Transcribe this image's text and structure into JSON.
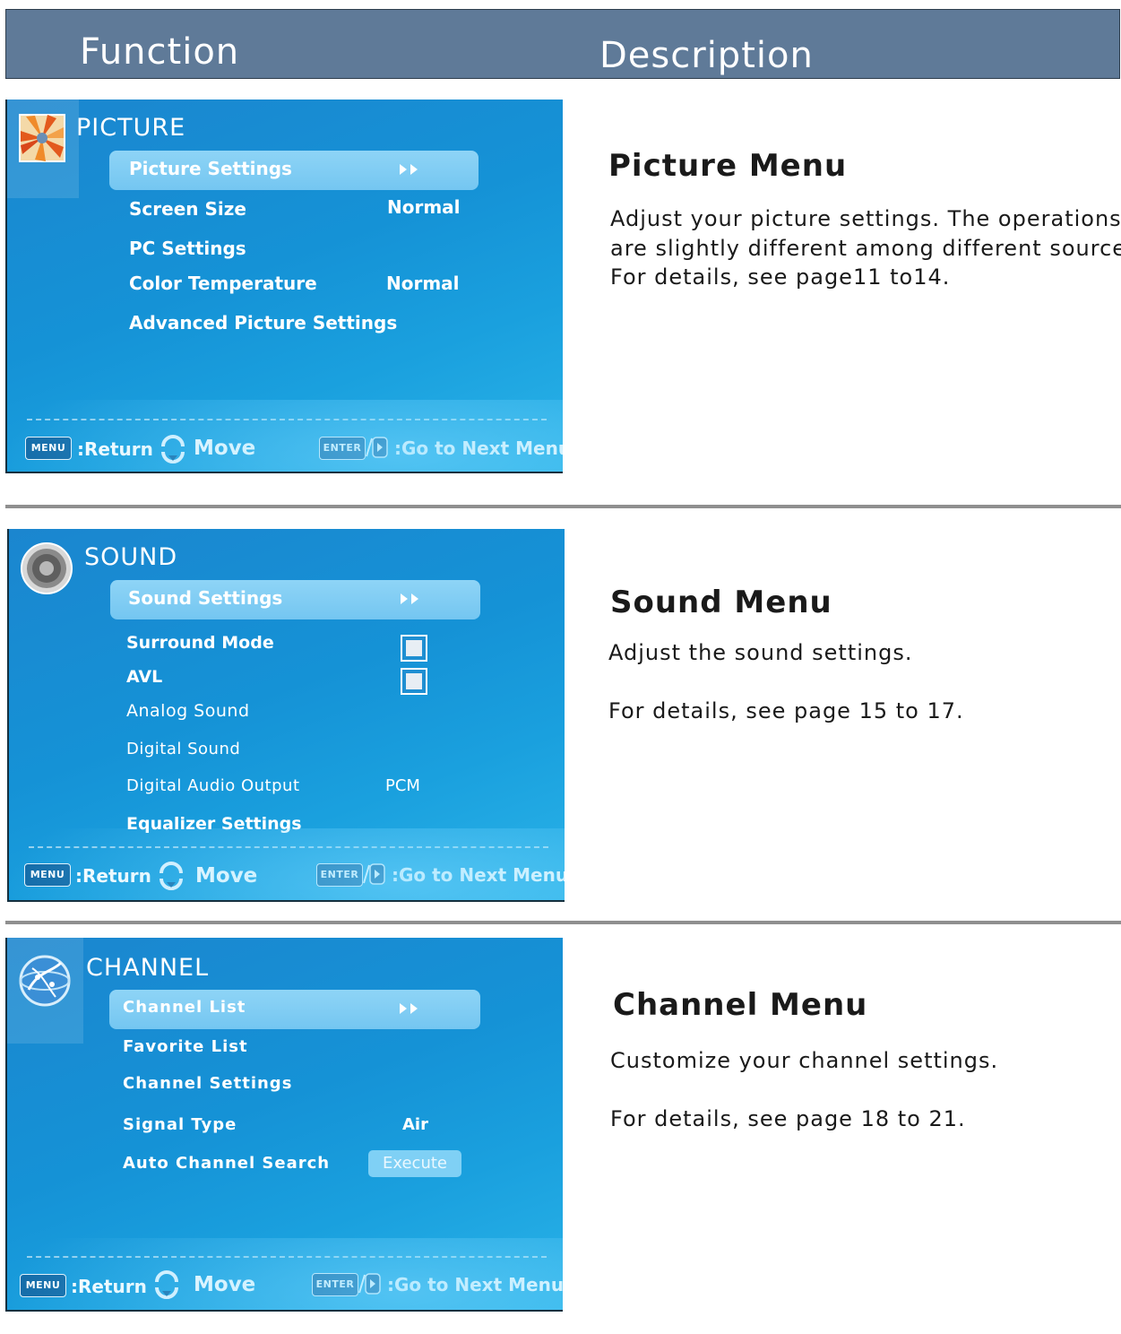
{
  "header": {
    "function_label": "Function",
    "description_label": "Description"
  },
  "picture": {
    "title": "PICTURE",
    "highlight": "Picture Settings",
    "items": [
      {
        "label": "Screen Size",
        "value": "Normal"
      },
      {
        "label": "PC Settings",
        "value": ""
      },
      {
        "label": "Color Temperature",
        "value": "Normal"
      },
      {
        "label": "Advanced Picture Settings",
        "value": ""
      }
    ]
  },
  "sound": {
    "title": "SOUND",
    "highlight": "Sound Settings",
    "items": [
      {
        "label": "Surround Mode"
      },
      {
        "label": "AVL"
      },
      {
        "label": "Analog Sound"
      },
      {
        "label": "Digital Sound"
      },
      {
        "label": "Digital Audio Output",
        "value": "PCM"
      },
      {
        "label": "Equalizer Settings"
      }
    ]
  },
  "channel": {
    "title": "CHANNEL",
    "highlight": "Channel List",
    "items": [
      {
        "label": "Favorite List"
      },
      {
        "label": "Channel Settings"
      },
      {
        "label": "Signal Type",
        "value": "Air"
      },
      {
        "label": "Auto Channel Search",
        "value": "Execute"
      }
    ]
  },
  "footer": {
    "menu_key": "MENU",
    "return_label": ":Return",
    "move_label": "Move",
    "enter_key": "ENTER",
    "next_label": ":Go to Next Menu"
  },
  "descriptions": {
    "picture": {
      "title": "Picture Menu",
      "line1": "Adjust your picture settings. The operations",
      "line2": "are slightly different among different source",
      "line3": "For details, see page11  to14."
    },
    "sound": {
      "title": "Sound Menu",
      "line1": "Adjust the sound settings.",
      "line2": "For details, see page 15 to 17."
    },
    "channel": {
      "title": "Channel  Menu",
      "line1": "Customize your channel settings.",
      "line2": "For details, see page 18 to 21."
    }
  },
  "icons": [
    "picture-icon",
    "speaker-icon",
    "globe-icon",
    "double-arrow-icon",
    "up-down-icon",
    "right-arrow-icon"
  ],
  "colors": {
    "header": "#5f7a98",
    "panel": "#1592d6",
    "highlight": "#8ed4f6",
    "divider": "#8f8f8f"
  }
}
